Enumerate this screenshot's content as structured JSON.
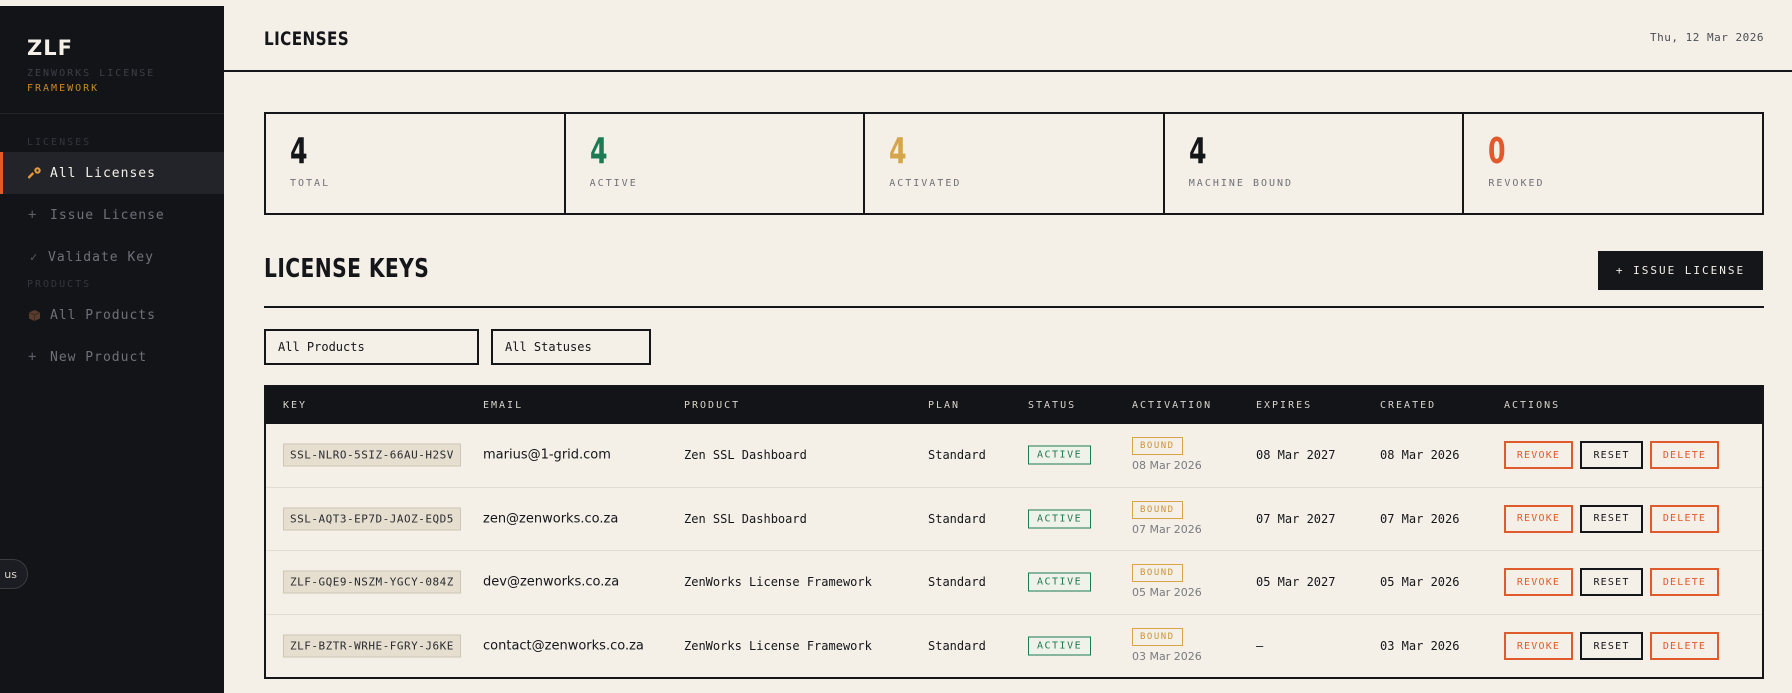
{
  "brand": {
    "title": "ZLF",
    "subtitle_line1": "ZENWORKS LICENSE",
    "subtitle_line2": "FRAMEWORK"
  },
  "sidebar": {
    "sections": [
      {
        "label": "LICENSES",
        "items": [
          {
            "label": "All Licenses",
            "icon": "key-icon",
            "active": true
          },
          {
            "label": "Issue License",
            "icon": "plus-icon",
            "active": false
          },
          {
            "label": "Validate Key",
            "icon": "check-icon",
            "active": false
          }
        ]
      },
      {
        "label": "PRODUCTS",
        "items": [
          {
            "label": "All Products",
            "icon": "box-icon",
            "active": false
          },
          {
            "label": "New Product",
            "icon": "plus-icon",
            "active": false
          }
        ]
      }
    ],
    "floating_pill": "us"
  },
  "header": {
    "title": "LICENSES",
    "date": "Thu, 12 Mar 2026"
  },
  "stats": [
    {
      "value": "4",
      "label": "TOTAL",
      "color": "#15161a"
    },
    {
      "value": "4",
      "label": "ACTIVE",
      "color": "#1d7a52"
    },
    {
      "value": "4",
      "label": "ACTIVATED",
      "color": "#d6a44a"
    },
    {
      "value": "4",
      "label": "MACHINE BOUND",
      "color": "#15161a"
    },
    {
      "value": "0",
      "label": "REVOKED",
      "color": "#e05a2b"
    }
  ],
  "section": {
    "title": "LICENSE KEYS",
    "issue_button": "+ ISSUE LICENSE"
  },
  "filters": {
    "product": "All Products",
    "status": "All Statuses"
  },
  "table": {
    "columns": [
      "KEY",
      "EMAIL",
      "PRODUCT",
      "PLAN",
      "STATUS",
      "ACTIVATION",
      "EXPIRES",
      "CREATED",
      "ACTIONS"
    ],
    "actions": {
      "revoke": "REVOKE",
      "reset": "RESET",
      "delete": "DELETE"
    },
    "rows": [
      {
        "key": "SSL-NLRO-5SIZ-66AU-H2SV",
        "email": "marius@1-grid.com",
        "product": "Zen SSL Dashboard",
        "plan": "Standard",
        "status": "ACTIVE",
        "activation": "BOUND",
        "activation_date": "08 Mar 2026",
        "expires": "08 Mar 2027",
        "created": "08 Mar 2026"
      },
      {
        "key": "SSL-AQT3-EP7D-JAOZ-EQD5",
        "email": "zen@zenworks.co.za",
        "product": "Zen SSL Dashboard",
        "plan": "Standard",
        "status": "ACTIVE",
        "activation": "BOUND",
        "activation_date": "07 Mar 2026",
        "expires": "07 Mar 2027",
        "created": "07 Mar 2026"
      },
      {
        "key": "ZLF-GQE9-NSZM-YGCY-084Z",
        "email": "dev@zenworks.co.za",
        "product": "ZenWorks License Framework",
        "plan": "Standard",
        "status": "ACTIVE",
        "activation": "BOUND",
        "activation_date": "05 Mar 2026",
        "expires": "05 Mar 2027",
        "created": "05 Mar 2026"
      },
      {
        "key": "ZLF-BZTR-WRHE-FGRY-J6KE",
        "email": "contact@zenworks.co.za",
        "product": "ZenWorks License Framework",
        "plan": "Standard",
        "status": "ACTIVE",
        "activation": "BOUND",
        "activation_date": "03 Mar 2026",
        "expires": "—",
        "created": "03 Mar 2026"
      }
    ]
  },
  "colors": {
    "accent": "#e05a2b",
    "success": "#1d7a52",
    "warning": "#d6a44a",
    "ink": "#15161a",
    "paper": "#f4efe7"
  }
}
